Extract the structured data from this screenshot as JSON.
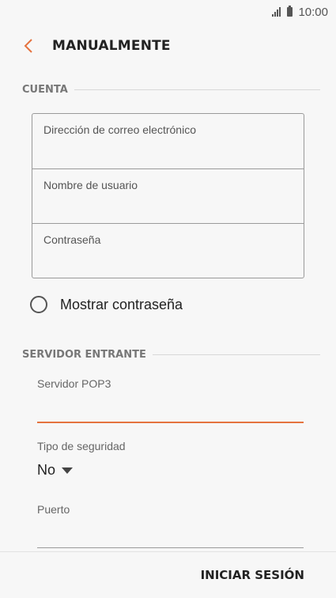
{
  "status_bar": {
    "time": "10:00",
    "icons": [
      "signal-icon",
      "battery-icon"
    ]
  },
  "header": {
    "title": "MANUALMENTE",
    "back_icon": "chevron-left-icon",
    "accent_color": "#e5733f"
  },
  "account_section": {
    "title": "CUENTA",
    "fields": [
      {
        "placeholder": "Dirección de correo electrónico"
      },
      {
        "placeholder": "Nombre de usuario"
      },
      {
        "placeholder": "Contraseña"
      }
    ],
    "show_password": {
      "label": "Mostrar contraseña",
      "checked": false
    }
  },
  "incoming_section": {
    "title": "SERVIDOR ENTRANTE",
    "server_label": "Servidor POP3",
    "security_label": "Tipo de seguridad",
    "security_value": "No",
    "port_label": "Puerto"
  },
  "bottom_bar": {
    "action_label": "INICIAR SESIÓN"
  }
}
